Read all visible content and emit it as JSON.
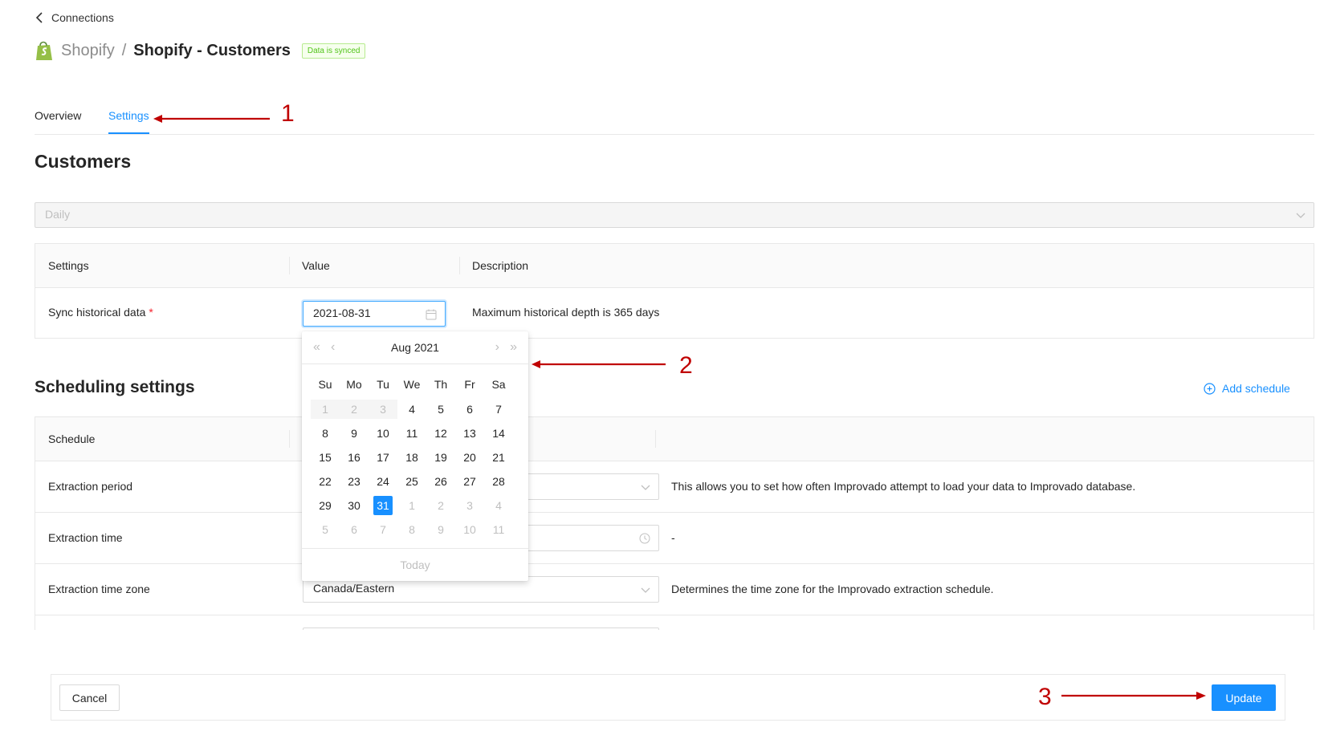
{
  "back_link": {
    "label": "Connections"
  },
  "header": {
    "parent": "Shopify",
    "separator": "/",
    "title": "Shopify - Customers",
    "badge": "Data is synced"
  },
  "tabs": [
    {
      "label": "Overview",
      "active": false
    },
    {
      "label": "Settings",
      "active": true
    }
  ],
  "section_title": "Customers",
  "frequency_select": {
    "value": "Daily",
    "disabled": true
  },
  "settings_table": {
    "headers": [
      "Settings",
      "Value",
      "Description"
    ],
    "rows": [
      {
        "label": "Sync historical data",
        "required_mark": "*",
        "value": "2021-08-31",
        "description": "Maximum historical depth is 365 days"
      }
    ]
  },
  "date_picker": {
    "month_year": "Aug  2021",
    "weekdays": [
      "Su",
      "Mo",
      "Tu",
      "We",
      "Th",
      "Fr",
      "Sa"
    ],
    "weeks": [
      [
        "1",
        "2",
        "3",
        "4",
        "5",
        "6",
        "7"
      ],
      [
        "8",
        "9",
        "10",
        "11",
        "12",
        "13",
        "14"
      ],
      [
        "15",
        "16",
        "17",
        "18",
        "19",
        "20",
        "21"
      ],
      [
        "22",
        "23",
        "24",
        "25",
        "26",
        "27",
        "28"
      ],
      [
        "29",
        "30",
        "31",
        "1",
        "2",
        "3",
        "4"
      ],
      [
        "5",
        "6",
        "7",
        "8",
        "9",
        "10",
        "11"
      ]
    ],
    "selected_day": "31",
    "today_label": "Today"
  },
  "scheduling": {
    "title": "Scheduling settings",
    "add_label": "Add schedule",
    "header": "Schedule",
    "rows": [
      {
        "label": "Extraction period",
        "value": "",
        "description": "This allows you to set how often Improvado attempt to load your data to Improvado database."
      },
      {
        "label": "Extraction time",
        "value": "",
        "description": "-"
      },
      {
        "label": "Extraction time zone",
        "value": "Canada/Eastern",
        "description": "Determines the time zone for the Improvado extraction schedule."
      }
    ]
  },
  "footer": {
    "cancel_label": "Cancel",
    "update_label": "Update"
  },
  "annotations": [
    "1",
    "2",
    "3"
  ],
  "colors": {
    "accent": "#1890ff",
    "success": "#52c41a",
    "annotation": "#c00000",
    "shopify": "#95bf47"
  }
}
